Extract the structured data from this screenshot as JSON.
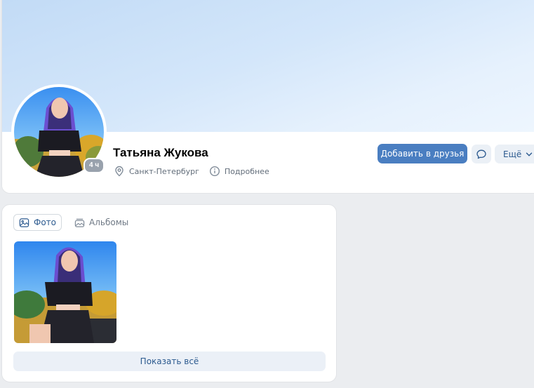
{
  "profile": {
    "name": "Татьяна Жукова",
    "last_seen": "4 ч",
    "city": "Санкт-Петербург",
    "details_label": "Подробнее"
  },
  "actions": {
    "add_friend_label": "Добавить в друзья",
    "message_icon": "message-bubble-icon",
    "more_label": "Ещё"
  },
  "photos": {
    "tabs": [
      {
        "label": "Фото",
        "icon": "photo-icon",
        "active": true
      },
      {
        "label": "Альбомы",
        "icon": "albums-icon",
        "active": false
      }
    ],
    "show_all_label": "Показать всё"
  },
  "colors": {
    "primary_button": "#4a7ec1",
    "secondary_button": "#ebf0f6",
    "link_text": "#2c5a8f",
    "page_background": "#ebedf0"
  }
}
